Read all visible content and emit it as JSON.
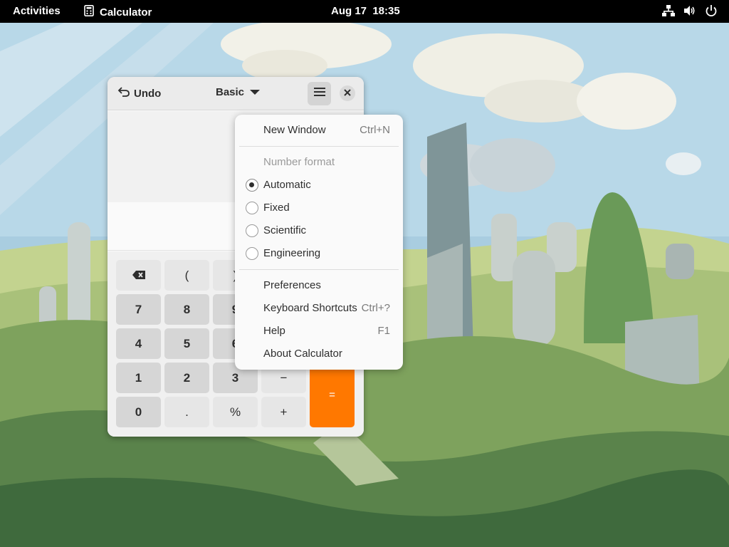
{
  "topbar": {
    "activities": "Activities",
    "app_name": "Calculator",
    "clock": "Aug 17  18:35",
    "tray_icons": [
      "network-icon",
      "volume-icon",
      "power-icon"
    ]
  },
  "calculator": {
    "undo_label": "Undo",
    "mode_label": "Basic",
    "keys": {
      "backspace": "⌫",
      "open_paren": "(",
      "close_paren": ")",
      "seven": "7",
      "eight": "8",
      "nine": "9",
      "four": "4",
      "five": "5",
      "six": "6",
      "one": "1",
      "two": "2",
      "three": "3",
      "zero": "0",
      "point": ".",
      "percent": "%",
      "minus": "−",
      "plus": "+",
      "equals": "="
    },
    "accent_color": "#ff7800"
  },
  "menu": {
    "new_window": "New Window",
    "new_window_shortcut": "Ctrl+N",
    "number_format_label": "Number format",
    "formats": [
      {
        "label": "Automatic",
        "checked": true
      },
      {
        "label": "Fixed",
        "checked": false
      },
      {
        "label": "Scientific",
        "checked": false
      },
      {
        "label": "Engineering",
        "checked": false
      }
    ],
    "preferences": "Preferences",
    "keyboard_shortcuts": "Keyboard Shortcuts",
    "keyboard_shortcuts_shortcut": "Ctrl+?",
    "help": "Help",
    "help_shortcut": "F1",
    "about": "About Calculator"
  }
}
